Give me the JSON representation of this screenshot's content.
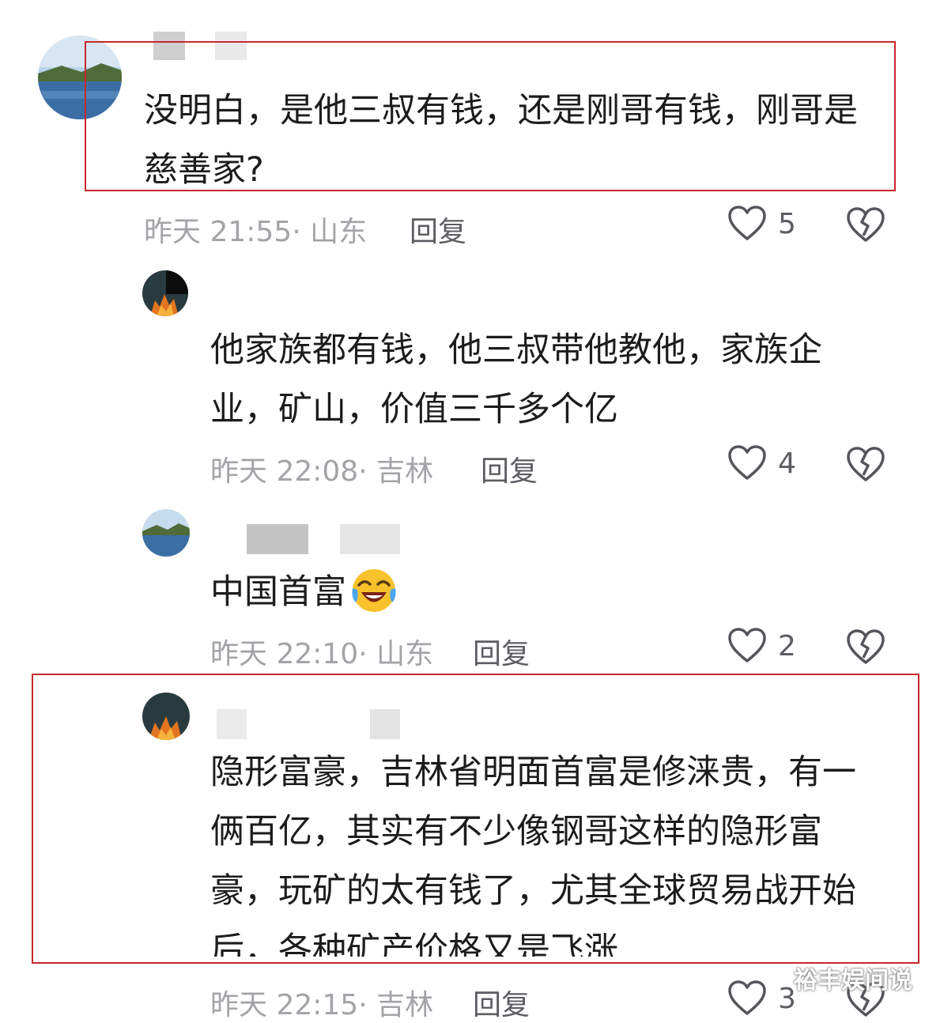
{
  "comments": [
    {
      "text": "没明白，是他三叔有钱，还是刚哥有钱，刚哥是慈善家?",
      "meta": "昨天 21:55· 山东",
      "reply_label": "回复",
      "likes": "5",
      "avatar_icon": "landscape-avatar"
    },
    {
      "text": "他家族都有钱，他三叔带他教他，家族企业，矿山，价值三千多个亿",
      "meta": "昨天 22:08· 吉林",
      "reply_label": "回复",
      "likes": "4",
      "avatar_icon": "fire-avatar"
    },
    {
      "text": "中国首富",
      "emoji": "laughing-crying-emoji",
      "meta": "昨天 22:10· 山东",
      "reply_label": "回复",
      "likes": "2",
      "avatar_icon": "landscape-avatar"
    },
    {
      "text": "隐形富豪，吉林省明面首富是修涞贵，有一俩百亿，其实有不少像钢哥这样的隐形富豪，玩矿的太有钱了，尤其全球贸易战开始后，各种矿产价格又是飞涨",
      "meta": "昨天 22:15· 吉林",
      "reply_label": "回复",
      "likes": "3",
      "avatar_icon": "fire-avatar"
    }
  ],
  "watermark": "裕丰娱间说",
  "colors": {
    "highlight_box": "#c8282d",
    "meta_text": "#a3a3a8",
    "body_text": "#1c1c1e"
  }
}
